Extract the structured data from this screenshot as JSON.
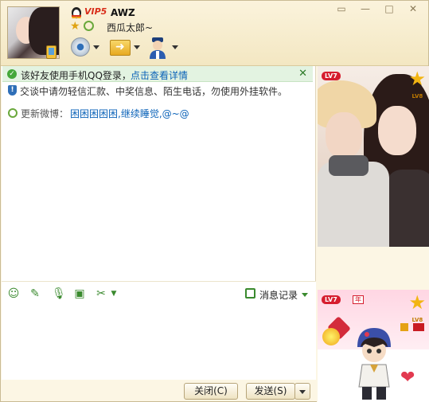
{
  "header": {
    "vip_label": "VIP5",
    "nickname": "AWZ",
    "signature": "西瓜太郎~",
    "window_buttons": [
      "▭",
      "—",
      "□",
      "✕"
    ]
  },
  "notices": {
    "mobile_login_text": "该好友使用手机QQ登录，",
    "mobile_login_link": "点击查看详情",
    "close_mark": "✕",
    "security_warning": "交谈中请勿轻信汇款、中奖信息、陌生电话，勿使用外挂软件。",
    "weibo_label": "更新微博：",
    "weibo_content": "困困困困困,继续睡觉,@~@"
  },
  "input_toolbar": {
    "history_label": "消息记录"
  },
  "footer": {
    "close_label": "关闭(C)",
    "send_label": "发送(S)"
  },
  "right_panel": {
    "friend_level_badge": "LV7",
    "friend_level_star": "LV8",
    "my_level_badge": "LV7",
    "my_year_badge": "年",
    "my_level_star": "LV8"
  },
  "colors": {
    "window_bg": "#fcf6e4",
    "notice_green": "#e3f3e1",
    "link_blue": "#0a62b8",
    "icon_green": "#3a8a2e",
    "vip_red": "#d82d1a"
  }
}
